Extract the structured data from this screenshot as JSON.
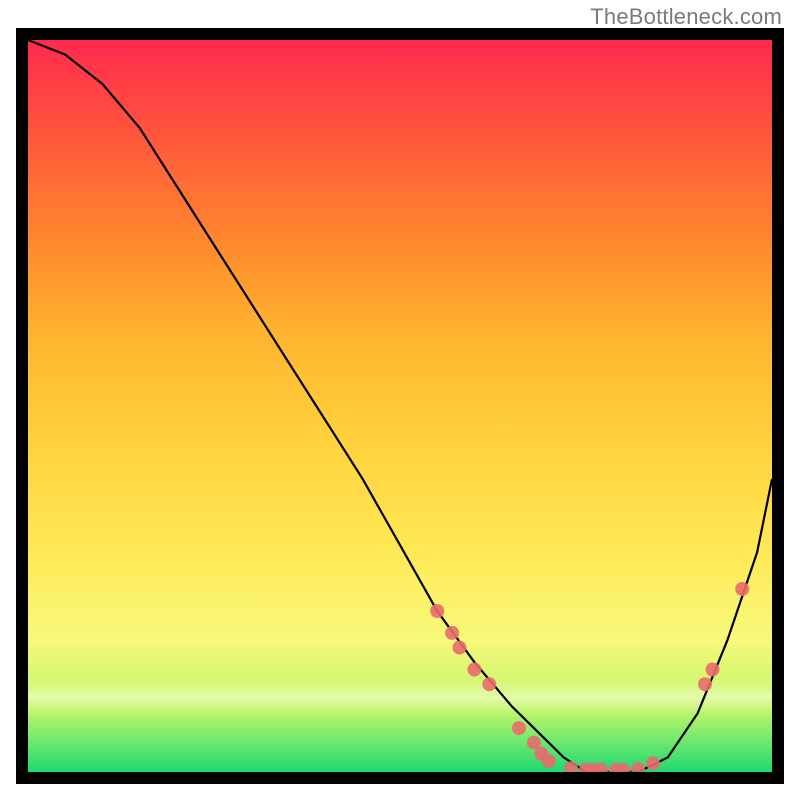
{
  "attribution": "TheBottleneck.com",
  "chart_data": {
    "type": "line",
    "title": "",
    "xlabel": "",
    "ylabel": "",
    "ylim": [
      0,
      100
    ],
    "xlim": [
      0,
      100
    ],
    "grid": false,
    "legend": false,
    "x": [
      0,
      5,
      10,
      15,
      20,
      25,
      30,
      35,
      40,
      45,
      50,
      55,
      60,
      65,
      70,
      72,
      75,
      78,
      82,
      86,
      90,
      94,
      98,
      100
    ],
    "values": [
      100,
      98,
      94,
      88,
      80,
      72,
      64,
      56,
      48,
      40,
      31,
      22,
      15,
      9,
      4,
      2,
      0,
      0,
      0,
      2,
      8,
      18,
      30,
      40
    ],
    "markers": [
      {
        "x": 55,
        "y": 22
      },
      {
        "x": 57,
        "y": 19
      },
      {
        "x": 58,
        "y": 17
      },
      {
        "x": 60,
        "y": 14
      },
      {
        "x": 62,
        "y": 12
      },
      {
        "x": 66,
        "y": 6
      },
      {
        "x": 68,
        "y": 4
      },
      {
        "x": 69,
        "y": 2.5
      },
      {
        "x": 70,
        "y": 1.5
      },
      {
        "x": 73,
        "y": 0.5
      },
      {
        "x": 75,
        "y": 0.3
      },
      {
        "x": 76,
        "y": 0.3
      },
      {
        "x": 77,
        "y": 0.3
      },
      {
        "x": 79,
        "y": 0.3
      },
      {
        "x": 80,
        "y": 0.3
      },
      {
        "x": 82,
        "y": 0.4
      },
      {
        "x": 84,
        "y": 1.2
      },
      {
        "x": 91,
        "y": 12
      },
      {
        "x": 92,
        "y": 14
      },
      {
        "x": 96,
        "y": 25
      }
    ],
    "colors": {
      "curve": "#000000",
      "marker": "#e86b6b",
      "gradient_top": "#ff2a4d",
      "gradient_mid": "#ffe956",
      "gradient_bottom": "#1ed972"
    }
  }
}
